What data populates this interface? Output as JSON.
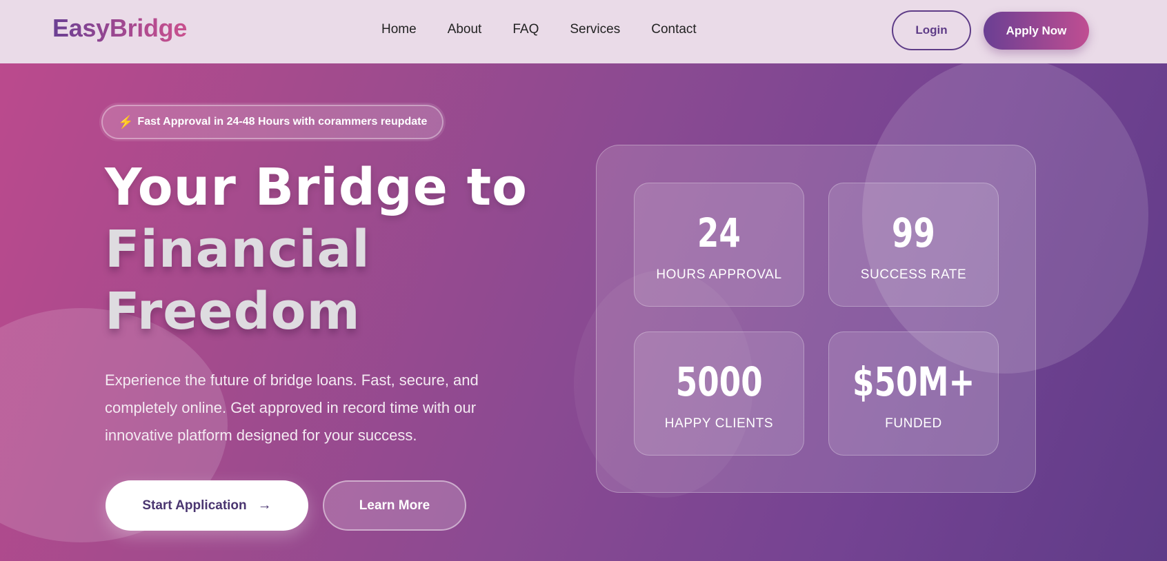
{
  "nav": {
    "logo": "EasyBridge",
    "links": [
      "Home",
      "About",
      "FAQ",
      "Services",
      "Contact"
    ],
    "login_label": "Login",
    "apply_label": "Apply Now"
  },
  "hero": {
    "badge": {
      "icon": "lightning-icon",
      "text": "Fast Approval in 24-48 Hours with corammers reupdate"
    },
    "headline_line1": "Your Bridge to",
    "headline_line2": "Financial",
    "headline_line3": "Freedom",
    "description": "Experience the future of bridge loans. Fast, secure, and completely online. Get approved in record time with our innovative platform designed for your success.",
    "start_label": "Start Application",
    "start_icon": "arrow-right-icon",
    "learn_label": "Learn More"
  },
  "stats": [
    {
      "value": "24",
      "label": "HOURS APPROVAL"
    },
    {
      "value": "99",
      "label": "SUCCESS RATE"
    },
    {
      "value": "5000",
      "label": "HAPPY CLIENTS"
    },
    {
      "value": "$50M+",
      "label": "FUNDED"
    }
  ],
  "colors": {
    "brand_purple": "#6a3f93",
    "brand_pink": "#c04e92",
    "nav_bg": "#eadbe8"
  }
}
